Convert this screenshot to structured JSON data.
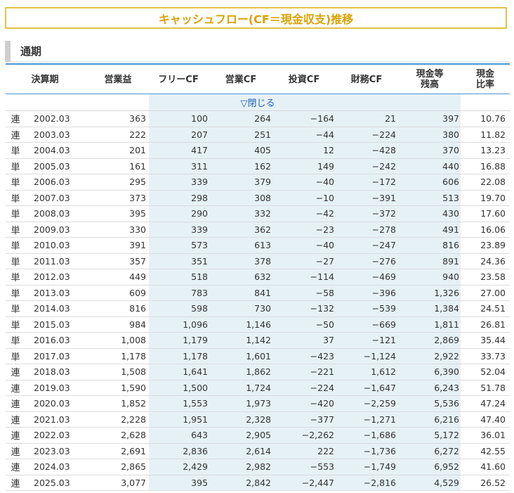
{
  "title": "キャッシュフロー(CF＝現金収支)推移",
  "section": "通期",
  "headers": {
    "period": "決算期",
    "operating_profit": "営業益",
    "free_cf": "フリーCF",
    "operating_cf": "営業CF",
    "investing_cf": "投資CF",
    "financing_cf": "財務CF",
    "cash_line1": "現金等",
    "cash_line2": "残高",
    "ratio_line1": "現金",
    "ratio_line2": "比率"
  },
  "toggle_label": "▽閉じる",
  "rows": [
    {
      "type": "連",
      "period": "2002.03",
      "op": "363",
      "fcf": "100",
      "ocf": "264",
      "icf": "−164",
      "fin": "21",
      "cash": "397",
      "ratio": "10.76"
    },
    {
      "type": "連",
      "period": "2003.03",
      "op": "222",
      "fcf": "207",
      "ocf": "251",
      "icf": "−44",
      "fin": "−224",
      "cash": "380",
      "ratio": "11.82"
    },
    {
      "type": "単",
      "period": "2004.03",
      "op": "201",
      "fcf": "417",
      "ocf": "405",
      "icf": "12",
      "fin": "−428",
      "cash": "370",
      "ratio": "13.23"
    },
    {
      "type": "単",
      "period": "2005.03",
      "op": "161",
      "fcf": "311",
      "ocf": "162",
      "icf": "149",
      "fin": "−242",
      "cash": "440",
      "ratio": "16.88"
    },
    {
      "type": "単",
      "period": "2006.03",
      "op": "295",
      "fcf": "339",
      "ocf": "379",
      "icf": "−40",
      "fin": "−172",
      "cash": "606",
      "ratio": "22.08"
    },
    {
      "type": "単",
      "period": "2007.03",
      "op": "373",
      "fcf": "298",
      "ocf": "308",
      "icf": "−10",
      "fin": "−391",
      "cash": "513",
      "ratio": "19.70"
    },
    {
      "type": "単",
      "period": "2008.03",
      "op": "395",
      "fcf": "290",
      "ocf": "332",
      "icf": "−42",
      "fin": "−372",
      "cash": "430",
      "ratio": "17.60"
    },
    {
      "type": "単",
      "period": "2009.03",
      "op": "330",
      "fcf": "339",
      "ocf": "362",
      "icf": "−23",
      "fin": "−278",
      "cash": "491",
      "ratio": "16.06"
    },
    {
      "type": "単",
      "period": "2010.03",
      "op": "391",
      "fcf": "573",
      "ocf": "613",
      "icf": "−40",
      "fin": "−247",
      "cash": "816",
      "ratio": "23.89"
    },
    {
      "type": "単",
      "period": "2011.03",
      "op": "357",
      "fcf": "351",
      "ocf": "378",
      "icf": "−27",
      "fin": "−276",
      "cash": "891",
      "ratio": "24.36"
    },
    {
      "type": "単",
      "period": "2012.03",
      "op": "449",
      "fcf": "518",
      "ocf": "632",
      "icf": "−114",
      "fin": "−469",
      "cash": "940",
      "ratio": "23.58"
    },
    {
      "type": "単",
      "period": "2013.03",
      "op": "609",
      "fcf": "783",
      "ocf": "841",
      "icf": "−58",
      "fin": "−396",
      "cash": "1,326",
      "ratio": "27.00"
    },
    {
      "type": "単",
      "period": "2014.03",
      "op": "816",
      "fcf": "598",
      "ocf": "730",
      "icf": "−132",
      "fin": "−539",
      "cash": "1,384",
      "ratio": "24.51"
    },
    {
      "type": "単",
      "period": "2015.03",
      "op": "984",
      "fcf": "1,096",
      "ocf": "1,146",
      "icf": "−50",
      "fin": "−669",
      "cash": "1,811",
      "ratio": "26.81"
    },
    {
      "type": "単",
      "period": "2016.03",
      "op": "1,008",
      "fcf": "1,179",
      "ocf": "1,142",
      "icf": "37",
      "fin": "−121",
      "cash": "2,869",
      "ratio": "35.44"
    },
    {
      "type": "単",
      "period": "2017.03",
      "op": "1,178",
      "fcf": "1,178",
      "ocf": "1,601",
      "icf": "−423",
      "fin": "−1,124",
      "cash": "2,922",
      "ratio": "33.73"
    },
    {
      "type": "連",
      "period": "2018.03",
      "op": "1,508",
      "fcf": "1,641",
      "ocf": "1,862",
      "icf": "−221",
      "fin": "1,612",
      "cash": "6,390",
      "ratio": "52.04"
    },
    {
      "type": "連",
      "period": "2019.03",
      "op": "1,590",
      "fcf": "1,500",
      "ocf": "1,724",
      "icf": "−224",
      "fin": "−1,647",
      "cash": "6,243",
      "ratio": "51.78"
    },
    {
      "type": "連",
      "period": "2020.03",
      "op": "1,852",
      "fcf": "1,553",
      "ocf": "1,973",
      "icf": "−420",
      "fin": "−2,259",
      "cash": "5,536",
      "ratio": "47.24"
    },
    {
      "type": "連",
      "period": "2021.03",
      "op": "2,228",
      "fcf": "1,951",
      "ocf": "2,328",
      "icf": "−377",
      "fin": "−1,271",
      "cash": "6,216",
      "ratio": "47.40"
    },
    {
      "type": "連",
      "period": "2022.03",
      "op": "2,628",
      "fcf": "643",
      "ocf": "2,905",
      "icf": "−2,262",
      "fin": "−1,686",
      "cash": "5,172",
      "ratio": "36.01"
    },
    {
      "type": "連",
      "period": "2023.03",
      "op": "2,691",
      "fcf": "2,836",
      "ocf": "2,614",
      "icf": "222",
      "fin": "−1,736",
      "cash": "6,272",
      "ratio": "42.55"
    },
    {
      "type": "連",
      "period": "2024.03",
      "op": "2,865",
      "fcf": "2,429",
      "ocf": "2,982",
      "icf": "−553",
      "fin": "−1,749",
      "cash": "6,952",
      "ratio": "41.60"
    },
    {
      "type": "連",
      "period": "2025.03",
      "op": "3,077",
      "fcf": "395",
      "ocf": "2,842",
      "icf": "−2,447",
      "fin": "−2,816",
      "cash": "4,529",
      "ratio": "26.52"
    }
  ]
}
